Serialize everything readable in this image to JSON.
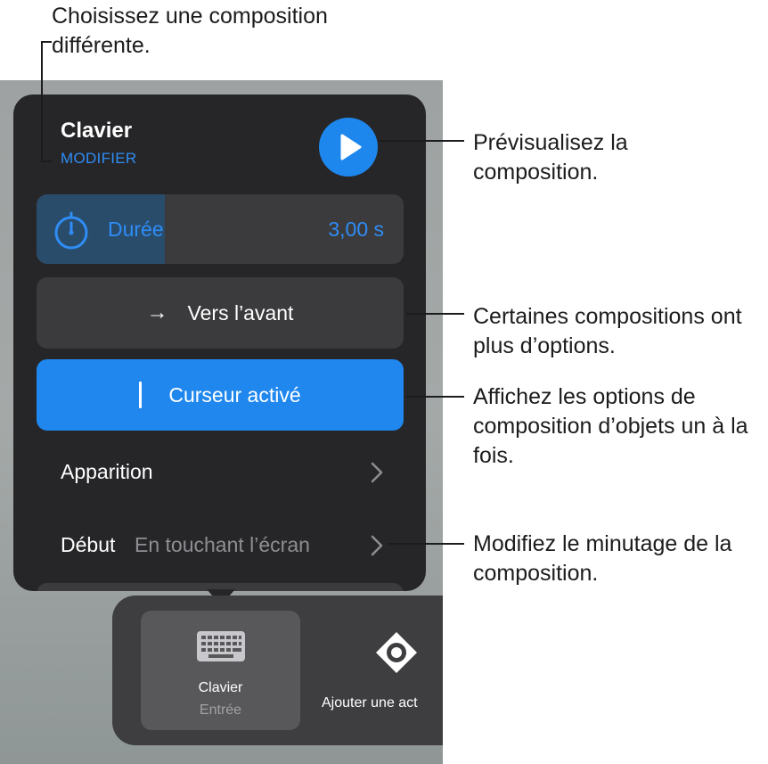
{
  "callouts": {
    "top": "Choisissez une composition différente.",
    "preview": "Prévisualisez la composition.",
    "options": "Certaines compositions ont plus d’options.",
    "objects": "Affichez les options de composition d’objets un à la fois.",
    "timing": "Modifiez le minutage de la composition."
  },
  "popover": {
    "title": "Clavier",
    "modify_label": "MODIFIER",
    "duration": {
      "label": "Durée",
      "value": "3,00 s",
      "fill_fraction": 0.35
    },
    "direction_button": "Vers l’avant",
    "cursor_button": "Curseur activé",
    "apparition": {
      "label": "Apparition"
    },
    "debut": {
      "label": "Début",
      "value": "En touchant l’écran"
    }
  },
  "toolbar": {
    "item1_label": "Clavier",
    "item1_sub": "Entrée",
    "item2_label": "Ajouter une act"
  },
  "colors": {
    "accent": "#2f8df6",
    "active_button": "#1f87ee",
    "panel": "#262628"
  }
}
